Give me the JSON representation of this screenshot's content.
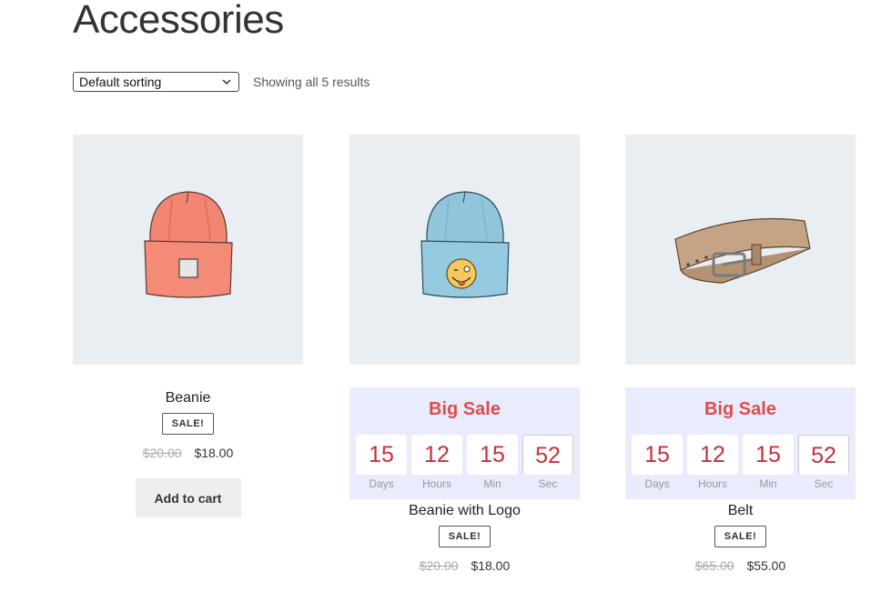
{
  "page": {
    "title": "Accessories"
  },
  "toolbar": {
    "sort_selected": "Default sorting",
    "result_count": "Showing all 5 results"
  },
  "colors": {
    "thumb_bg": "#e9eef2",
    "sale_box_bg": "#e8ecfd",
    "sale_title": "#e14b4b",
    "timer_digits": "#c8303a"
  },
  "products": [
    {
      "name": "Beanie",
      "badge": "SALE!",
      "old_price": "$20.00",
      "price": "$18.00",
      "button": "Add to cart",
      "image_icon": "orange-beanie-icon"
    },
    {
      "name": "Beanie with Logo",
      "badge": "SALE!",
      "old_price": "$20.00",
      "price": "$18.00",
      "image_icon": "blue-beanie-logo-icon",
      "sale": {
        "title": "Big Sale",
        "timer": [
          {
            "value": "15",
            "unit": "Days"
          },
          {
            "value": "12",
            "unit": "Hours"
          },
          {
            "value": "15",
            "unit": "Min"
          },
          {
            "value": "52",
            "unit": "Sec"
          }
        ]
      }
    },
    {
      "name": "Belt",
      "badge": "SALE!",
      "old_price": "$65.00",
      "price": "$55.00",
      "image_icon": "leather-belt-icon",
      "sale": {
        "title": "Big Sale",
        "timer": [
          {
            "value": "15",
            "unit": "Days"
          },
          {
            "value": "12",
            "unit": "Hours"
          },
          {
            "value": "15",
            "unit": "Min"
          },
          {
            "value": "52",
            "unit": "Sec"
          }
        ]
      }
    }
  ]
}
